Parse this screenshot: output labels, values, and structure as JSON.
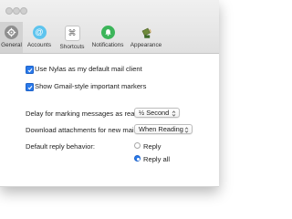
{
  "toolbar": {
    "tabs": [
      {
        "label": "General",
        "icon": "gear-icon",
        "selected": true
      },
      {
        "label": "Accounts",
        "icon": "at-sign-icon",
        "selected": false
      },
      {
        "label": "Shortcuts",
        "icon": "command-key-icon",
        "selected": false
      },
      {
        "label": "Notifications",
        "icon": "bell-icon",
        "selected": false
      },
      {
        "label": "Appearance",
        "icon": "paint-bucket-icon",
        "selected": false
      }
    ]
  },
  "general": {
    "default_client": {
      "label": "Use Nylas as my default mail client",
      "checked": true
    },
    "gmail_markers": {
      "label": "Show Gmail-style important markers",
      "checked": true
    },
    "delay_label": "Delay for marking messages as read:",
    "delay_value": "½ Second",
    "download_label": "Download attachments for new mail:",
    "download_value": "When Reading",
    "reply_label": "Default reply behavior:",
    "reply_options": [
      {
        "label": "Reply",
        "selected": false
      },
      {
        "label": "Reply all",
        "selected": true
      }
    ]
  },
  "colors": {
    "accent": "#2a79ea",
    "tab_selected_bg": "#d2d2d2",
    "titlebar_bg": "#e6e6e6"
  }
}
